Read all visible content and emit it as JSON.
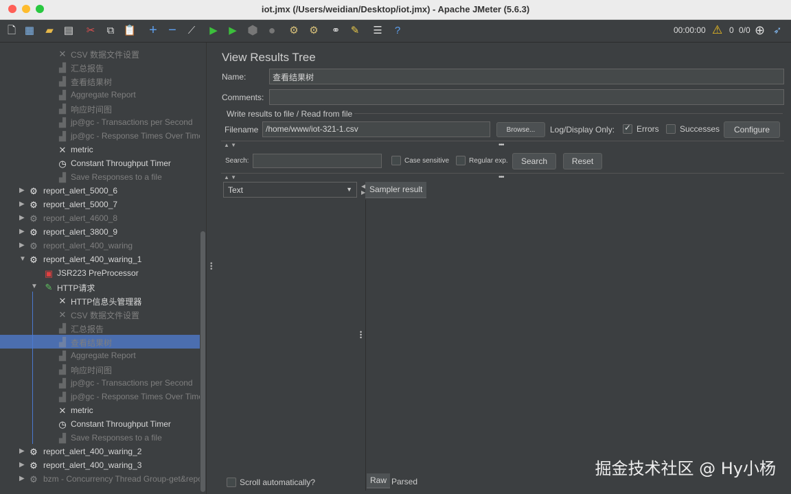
{
  "window": {
    "title": "iot.jmx (/Users/weidian/Desktop/iot.jmx) - Apache JMeter (5.6.3)",
    "traffic_lights": [
      "#ff5f57",
      "#febc2e",
      "#28c840"
    ]
  },
  "toolbar": {
    "icons": [
      "new-icon",
      "templates-icon",
      "open-icon",
      "save-icon",
      "cut-icon",
      "copy-icon",
      "paste-icon",
      "expand-icon",
      "collapse-icon",
      "toggle-icon",
      "start-icon",
      "start-no-pause-icon",
      "stop-icon",
      "shutdown-icon",
      "clear-icon",
      "clear-all-icon",
      "search-icon",
      "reset-search-icon",
      "function-helper-icon",
      "help-icon"
    ],
    "timer": "00:00:00",
    "warnings": "0",
    "threads": "0/0"
  },
  "tree": {
    "items": [
      {
        "label": "CSV 数据文件设置",
        "icon": "tools-icon",
        "dim": true,
        "level": 3
      },
      {
        "label": "汇总报告",
        "icon": "chart-icon",
        "dim": true,
        "level": 3
      },
      {
        "label": "查看结果树",
        "icon": "chart-icon",
        "dim": true,
        "level": 3
      },
      {
        "label": "Aggregate Report",
        "icon": "chart-icon",
        "dim": true,
        "level": 3
      },
      {
        "label": "响应时间图",
        "icon": "chart-icon",
        "dim": true,
        "level": 3
      },
      {
        "label": "jp@gc - Transactions per Second",
        "icon": "chart-icon",
        "dim": true,
        "level": 3
      },
      {
        "label": "jp@gc - Response Times Over Time",
        "icon": "chart-icon",
        "dim": true,
        "level": 3
      },
      {
        "label": "metric",
        "icon": "tools-icon",
        "dim": false,
        "level": 3
      },
      {
        "label": "Constant Throughput Timer",
        "icon": "timer-icon",
        "dim": false,
        "level": 3
      },
      {
        "label": "Save Responses to a file",
        "icon": "chart-icon",
        "dim": true,
        "level": 3
      },
      {
        "label": "report_alert_5000_6",
        "icon": "gear-icon",
        "dim": false,
        "level": 1,
        "arrow": "▶"
      },
      {
        "label": "report_alert_5000_7",
        "icon": "gear-icon",
        "dim": false,
        "level": 1,
        "arrow": "▶"
      },
      {
        "label": "report_alert_4600_8",
        "icon": "gear-icon",
        "dim": true,
        "level": 1,
        "arrow": "▶"
      },
      {
        "label": "report_alert_3800_9",
        "icon": "gear-icon",
        "dim": false,
        "level": 1,
        "arrow": "▶"
      },
      {
        "label": "report_alert_400_waring",
        "icon": "gear-icon",
        "dim": true,
        "level": 1,
        "arrow": "▶"
      },
      {
        "label": "report_alert_400_waring_1",
        "icon": "gear-icon",
        "dim": false,
        "level": 1,
        "arrow": "▼"
      },
      {
        "label": "JSR223 PreProcessor",
        "icon": "script-icon",
        "dim": false,
        "level": 2
      },
      {
        "label": "HTTP请求",
        "icon": "pipette-icon",
        "dim": false,
        "level": 2,
        "arrow": "▼"
      },
      {
        "label": "HTTP信息头管理器",
        "icon": "tools-icon",
        "dim": false,
        "level": 3
      },
      {
        "label": "CSV 数据文件设置",
        "icon": "tools-icon",
        "dim": true,
        "level": 3
      },
      {
        "label": "汇总报告",
        "icon": "chart-icon",
        "dim": true,
        "level": 3
      },
      {
        "label": "查看结果树",
        "icon": "chart-icon",
        "dim": true,
        "level": 3,
        "selected": true
      },
      {
        "label": "Aggregate Report",
        "icon": "chart-icon",
        "dim": true,
        "level": 3
      },
      {
        "label": "响应时间图",
        "icon": "chart-icon",
        "dim": true,
        "level": 3
      },
      {
        "label": "jp@gc - Transactions per Second",
        "icon": "chart-icon",
        "dim": true,
        "level": 3
      },
      {
        "label": "jp@gc - Response Times Over Time",
        "icon": "chart-icon",
        "dim": true,
        "level": 3
      },
      {
        "label": "metric",
        "icon": "tools-icon",
        "dim": false,
        "level": 3
      },
      {
        "label": "Constant Throughput Timer",
        "icon": "timer-icon",
        "dim": false,
        "level": 3
      },
      {
        "label": "Save Responses to a file",
        "icon": "chart-icon",
        "dim": true,
        "level": 3
      },
      {
        "label": "report_alert_400_waring_2",
        "icon": "gear-icon",
        "dim": false,
        "level": 1,
        "arrow": "▶"
      },
      {
        "label": "report_alert_400_waring_3",
        "icon": "gear-icon",
        "dim": false,
        "level": 1,
        "arrow": "▶"
      },
      {
        "label": "bzm - Concurrency Thread Group-get&report",
        "icon": "gear-icon",
        "dim": true,
        "level": 1,
        "arrow": "▶"
      }
    ]
  },
  "panel": {
    "title": "View Results Tree",
    "name_label": "Name:",
    "name_value": "查看结果树",
    "comments_label": "Comments:",
    "comments_value": "",
    "write_results_label": "Write results to file / Read from file",
    "filename_label": "Filename",
    "filename_value": "/home/www/iot-321-1.csv",
    "browse_label": "Browse...",
    "log_display_label": "Log/Display Only:",
    "errors_label": "Errors",
    "successes_label": "Successes",
    "configure_label": "Configure",
    "search_label": "Search:",
    "search_value": "",
    "case_sensitive_label": "Case sensitive",
    "regular_exp_label": "Regular exp.",
    "search_button": "Search",
    "reset_button": "Reset",
    "renderer_value": "Text",
    "sampler_result_tab": "Sampler result",
    "scroll_auto_label": "Scroll automatically?",
    "raw_tab": "Raw",
    "parsed_tab": "Parsed"
  },
  "watermark": "掘金技术社区 @ Hy小杨"
}
